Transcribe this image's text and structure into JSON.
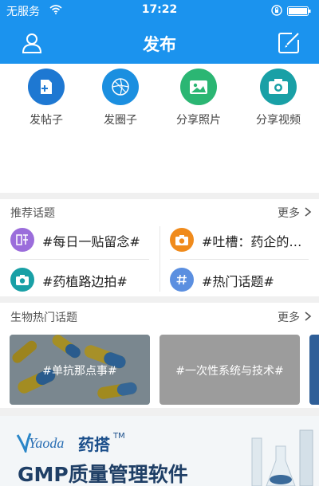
{
  "status_bar": {
    "carrier": "无服务",
    "time": "17:22"
  },
  "nav": {
    "title": "发布"
  },
  "actions": [
    {
      "label": "发帖子",
      "icon": "post-icon",
      "color": "#1e78d2"
    },
    {
      "label": "发圈子",
      "icon": "circle-icon",
      "color": "#1b8fe0"
    },
    {
      "label": "分享照片",
      "icon": "photo-icon",
      "color": "#2bb673"
    },
    {
      "label": "分享视频",
      "icon": "video-icon",
      "color": "#19a0a6"
    }
  ],
  "recommended": {
    "title": "推荐话题",
    "more": "更多",
    "topics": [
      {
        "label": "#每日一贴留念#",
        "icon": "sticker-icon",
        "color": "#9b6ddb"
      },
      {
        "label": "#吐槽：药企的…",
        "icon": "camera-icon",
        "color": "#f08b1c"
      },
      {
        "label": "#药植路边拍#",
        "icon": "camera-icon",
        "color": "#19a0a6"
      },
      {
        "label": "#热门话题#",
        "icon": "hash-icon",
        "color": "#5b8fe0"
      }
    ]
  },
  "bio": {
    "title": "生物热门话题",
    "more": "更多",
    "cards": [
      {
        "label": "#单抗那点事#"
      },
      {
        "label": "#一次性系统与技术#"
      }
    ]
  },
  "banner": {
    "logo_latin": "Yaoda",
    "logo_cn": "药搭",
    "logo_tm": "TM",
    "headline": "GMP质量管理软件"
  }
}
